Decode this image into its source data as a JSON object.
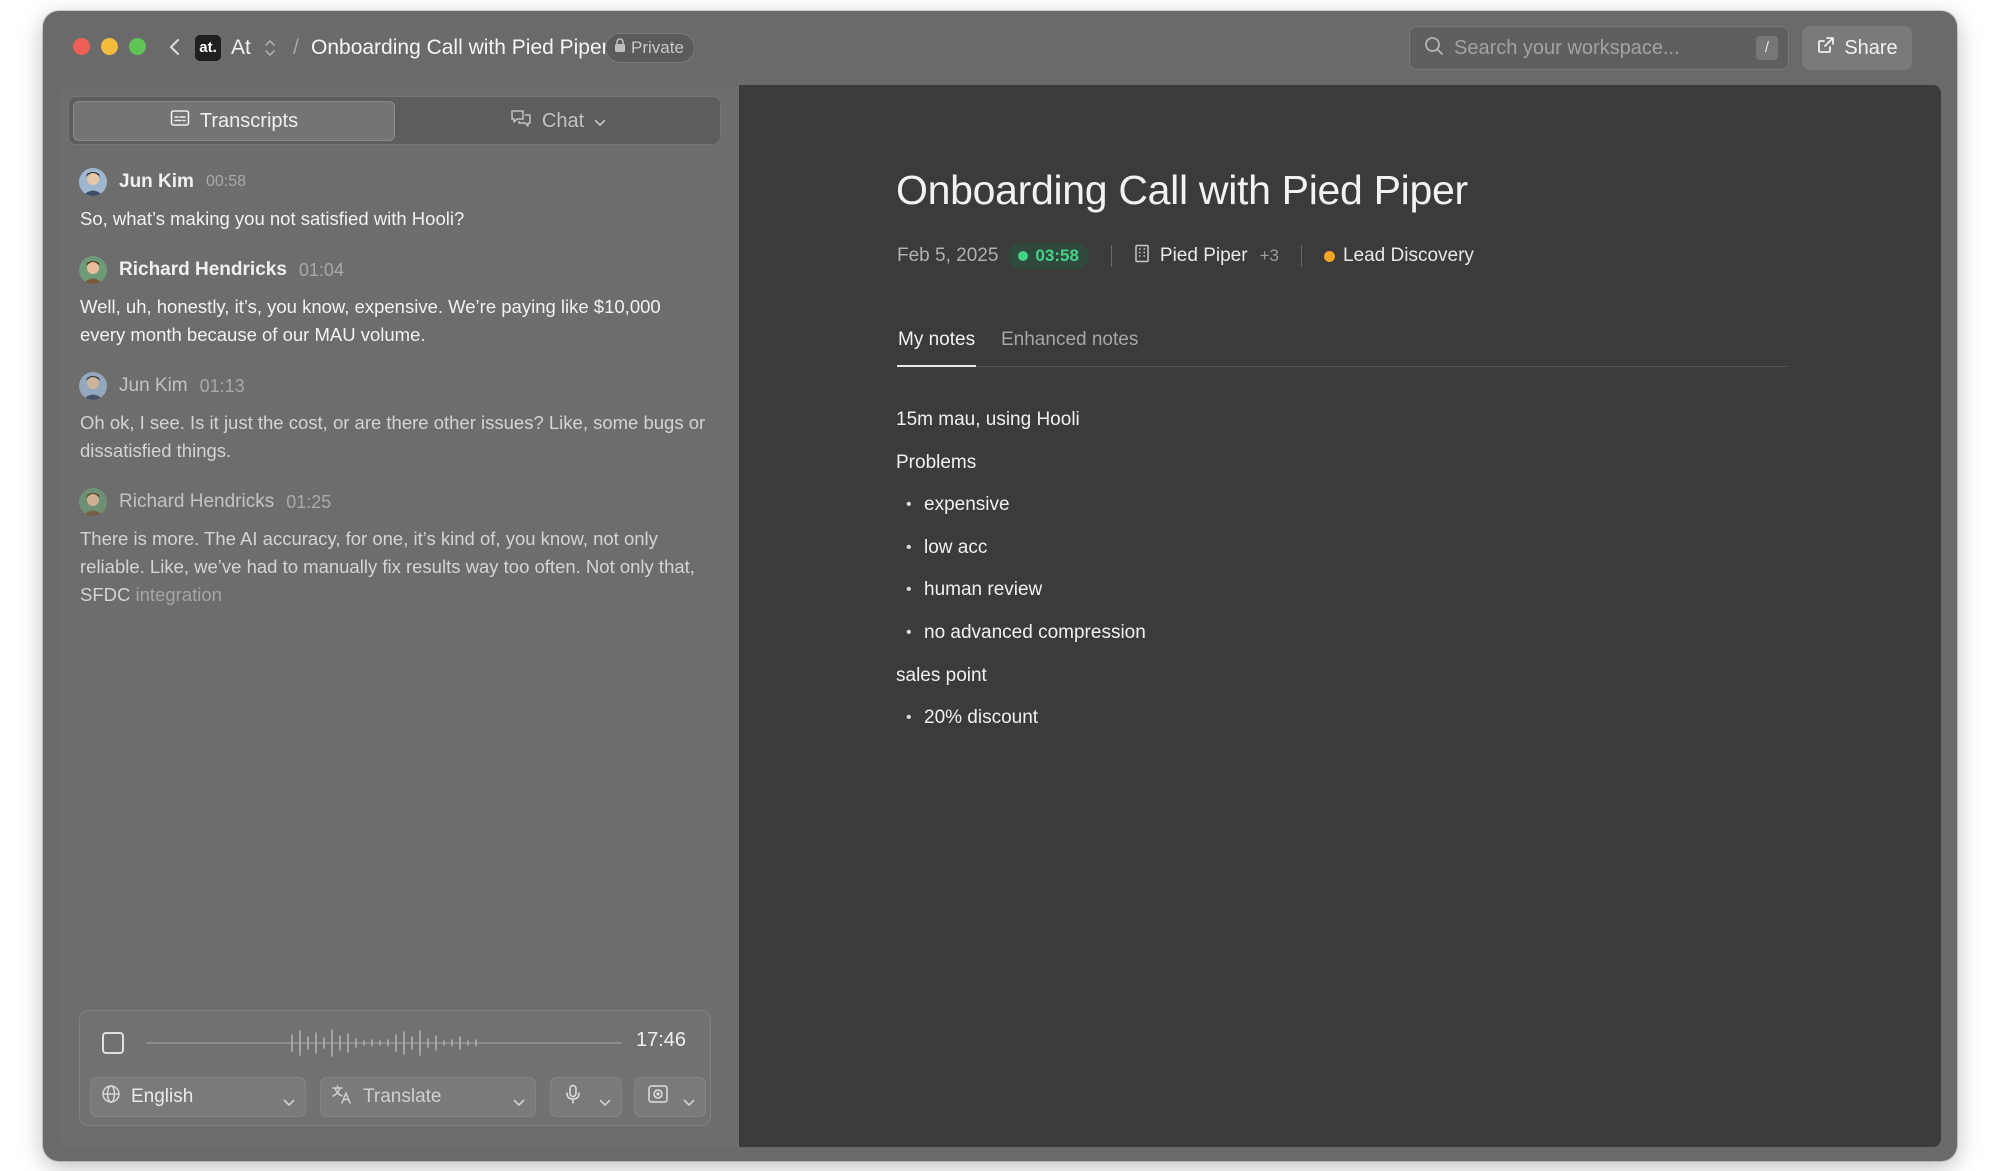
{
  "titlebar": {
    "workspace_logo": "at.",
    "workspace_name": "At",
    "breadcrumb_sep": "/",
    "meeting_title": "Onboarding Call with Pied Piper",
    "privacy_label": "Private",
    "search_placeholder": "Search your workspace...",
    "search_shortcut": "/",
    "share_label": "Share"
  },
  "left": {
    "tabs": [
      {
        "label": "Transcripts",
        "icon": "captions-icon",
        "active": true
      },
      {
        "label": "Chat",
        "icon": "chat-icon",
        "active": false
      }
    ],
    "messages": [
      {
        "speaker": "Jun Kim",
        "time": "00:58",
        "text": "So, what’s making you not satisfied with Hooli?"
      },
      {
        "speaker": "Richard Hendricks",
        "time": "01:04",
        "text": "Well, uh, honestly, it’s, you know, expensive. We’re paying like $10,000 every month because of our MAU volume."
      },
      {
        "speaker": "Jun Kim",
        "time": "01:13",
        "text": "Oh ok, I see. Is it just the cost, or are there other issues? Like, some bugs or dissatisfied things."
      },
      {
        "speaker": "Richard Hendricks",
        "time": "01:25",
        "text": "There is more. The AI accuracy, for one, it’s kind of, you know, not only reliable. Like, we’ve had to manually fix results way too often. Not only that, SFDC",
        "text_faded": "integration"
      }
    ],
    "player": {
      "elapsed": "17:46",
      "language": "English",
      "translate": "Translate"
    }
  },
  "doc": {
    "title": "Onboarding Call with Pied Piper",
    "date": "Feb 5, 2025",
    "duration": "03:58",
    "company": "Pied Piper",
    "company_extra": "+3",
    "tag": "Lead Discovery",
    "tabs": [
      "My notes",
      "Enhanced notes"
    ],
    "notes": [
      {
        "text": "15m mau, using Hooli",
        "bullet": false
      },
      {
        "text": "Problems",
        "bullet": false
      },
      {
        "text": "expensive",
        "bullet": true
      },
      {
        "text": "low acc",
        "bullet": true
      },
      {
        "text": "human review",
        "bullet": true
      },
      {
        "text": "no advanced compression",
        "bullet": true
      },
      {
        "text": "sales point",
        "bullet": false
      },
      {
        "text": "20% discount",
        "bullet": true
      }
    ]
  },
  "colors": {
    "duration_green": "#42d384",
    "tag_orange": "#f5a524",
    "traffic_red": "#ed5e55",
    "traffic_yellow": "#f4bc3c",
    "traffic_green": "#5fc454"
  }
}
